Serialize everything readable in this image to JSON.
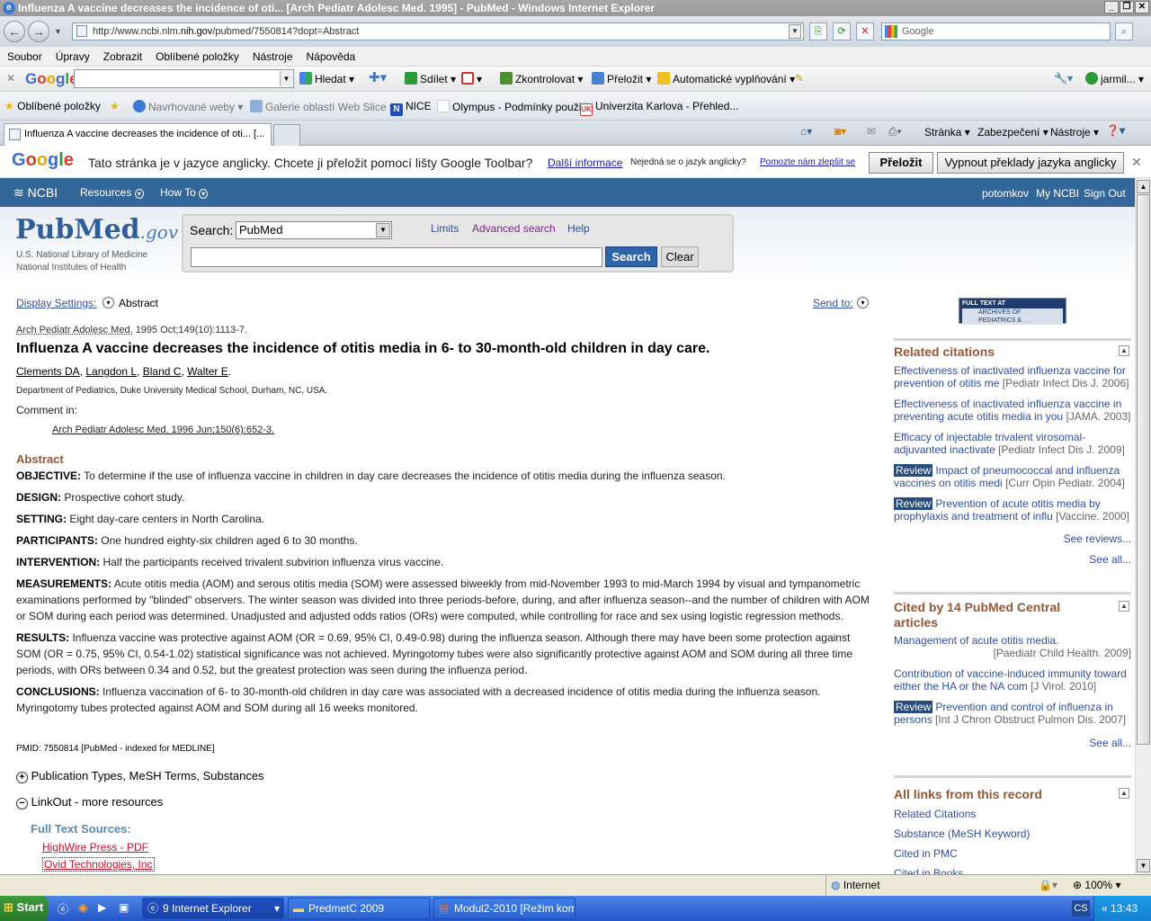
{
  "window": {
    "title": "Influenza A vaccine decreases the incidence of oti... [Arch Pediatr Adolesc Med. 1995] - PubMed - Windows Internet Explorer"
  },
  "address_bar": {
    "url_prefix": "http://www.ncbi.nlm.",
    "url_domain": "nih.gov",
    "url_suffix": "/pubmed/7550814?dopt=Abstract",
    "search_placeholder": "Google"
  },
  "menu": [
    "Soubor",
    "Úpravy",
    "Zobrazit",
    "Oblíbené položky",
    "Nástroje",
    "Nápověda"
  ],
  "google_toolbar": {
    "search_label": "Hledat",
    "share_label": "Sdílet",
    "check_label": "Zkontrolovat",
    "translate_label": "Přeložit",
    "autofill_label": "Automatické vyplňování",
    "user_label": "jarmil..."
  },
  "favorites": {
    "label": "Oblíbené položky",
    "items": [
      "Navrhované weby",
      "Galerie oblastí Web Slice",
      "NICE",
      "Olympus - Podmínky použití",
      "Univerzita Karlova - Přehled..."
    ]
  },
  "tab": {
    "title": "Influenza A vaccine decreases the incidence of oti... [..."
  },
  "command_bar": [
    "Stránka",
    "Zabezpečení",
    "Nástroje"
  ],
  "translate_bar": {
    "message": "Tato stránka je v jazyce anglicky. Chcete ji přeložit pomocí lišty Google Toolbar?",
    "more_info": "Další informace",
    "not_english": "Nejedná se o jazyk anglicky?",
    "help_improve": "Pomozte nám zlepšit se",
    "translate_btn": "Přeložit",
    "disable_btn": "Vypnout překlady jazyka anglicky"
  },
  "ncbi": {
    "logo": "NCBI",
    "resources": "Resources",
    "howto": "How To",
    "user": "potomkov",
    "my_ncbi": "My NCBI",
    "sign_out": "Sign Out"
  },
  "pubmed": {
    "logo_pub": "Pub",
    "logo_med": "Med",
    "logo_gov": ".gov",
    "nlm": "U.S. National Library of Medicine",
    "nih": "National Institutes of Health",
    "search_label": "Search:",
    "db_selected": "PubMed",
    "limits": "Limits",
    "advanced": "Advanced search",
    "help": "Help",
    "search_btn": "Search",
    "clear_btn": "Clear"
  },
  "article": {
    "display_settings": "Display Settings:",
    "display_value": "Abstract",
    "send_to": "Send to:",
    "journal": "Arch Pediatr Adolesc Med.",
    "citation": "1995 Oct;149(10):1113-7.",
    "title": "Influenza A vaccine decreases the incidence of otitis media in 6- to 30-month-old children in day care.",
    "authors": [
      "Clements DA",
      "Langdon L",
      "Bland C",
      "Walter E"
    ],
    "affiliation": "Department of Pediatrics, Duke University Medical School, Durham, NC, USA.",
    "comment_label": "Comment in:",
    "comment_link": "Arch Pediatr Adolesc Med. 1996 Jun;150(6):652-3.",
    "abstract_heading": "Abstract",
    "abstract": [
      {
        "label": "OBJECTIVE:",
        "text": "To determine if the use of influenza vaccine in children in day care decreases the incidence of otitis media during the influenza season."
      },
      {
        "label": "DESIGN:",
        "text": "Prospective cohort study."
      },
      {
        "label": "SETTING:",
        "text": "Eight day-care centers in North Carolina."
      },
      {
        "label": "PARTICIPANTS:",
        "text": "One hundred eighty-six children aged 6 to 30 months."
      },
      {
        "label": "INTERVENTION:",
        "text": "Half the participants received trivalent subvirion influenza virus vaccine."
      },
      {
        "label": "MEASUREMENTS:",
        "text": "Acute otitis media (AOM) and serous otitis media (SOM) were assessed biweekly from mid-November 1993 to mid-March 1994 by visual and tympanometric examinations performed by \"blinded\" observers. The winter season was divided into three periods-before, during, and after influenza season--and the number of children with AOM or SOM during each period was determined. Unadjusted and adjusted odds ratios (ORs) were computed, while controlling for race and sex using logistic regression methods."
      },
      {
        "label": "RESULTS:",
        "text": "Influenza vaccine was protective against AOM (OR = 0.69, 95% CI, 0.49-0.98) during the influenza season. Although there may have been some protection against SOM (OR = 0.75, 95% CI, 0.54-1.02) statistical significance was not achieved. Myringotomy tubes were also significantly protective against AOM and SOM during all three time periods, with ORs between 0.34 and 0.52, but the greatest protection was seen during the influenza period."
      },
      {
        "label": "CONCLUSIONS:",
        "text": "Influenza vaccination of 6- to 30-month-old children in day care was associated with a decreased incidence of otitis media during the influenza season. Myringotomy tubes protected against AOM and SOM during all 16 weeks monitored."
      }
    ],
    "pmid": "PMID: 7550814 [PubMed - indexed for MEDLINE]",
    "pub_types": "Publication Types, MeSH Terms, Substances",
    "linkout": "LinkOut - more resources",
    "fulltext_heading": "Full Text Sources:",
    "fulltext_links": [
      "HighWire Press - PDF",
      "Ovid Technologies, Inc"
    ]
  },
  "sidebar": {
    "fulltext_badge_line1": "FULL TEXT AT",
    "fulltext_badge_line2": "ARCHIVES OF",
    "fulltext_badge_line3": "PEDIATRICS & . . .",
    "related_title": "Related citations",
    "related": [
      {
        "review": false,
        "text": "Effectiveness of inactivated influenza vaccine for prevention of otitis me",
        "cite": "[Pediatr Infect Dis J. 2006]"
      },
      {
        "review": false,
        "text": "Effectiveness of inactivated influenza vaccine in preventing acute otitis media in you",
        "cite": "[JAMA. 2003]"
      },
      {
        "review": false,
        "text": "Efficacy of injectable trivalent virosomal-adjuvanted inactivate",
        "cite": "[Pediatr Infect Dis J. 2009]"
      },
      {
        "review": true,
        "text": "Impact of pneumococcal and influenza vaccines on otitis medi",
        "cite": "[Curr Opin Pediatr. 2004]"
      },
      {
        "review": true,
        "text": "Prevention of acute otitis media by prophylaxis and treatment of influ",
        "cite": "[Vaccine. 2000]"
      }
    ],
    "review_label": "Review",
    "see_reviews": "See reviews...",
    "see_all": "See all...",
    "cited_title": "Cited by 14 PubMed Central articles",
    "cited": [
      {
        "review": false,
        "text": "Management of acute otitis media.",
        "cite": "[Paediatr Child Health. 2009]"
      },
      {
        "review": false,
        "text": "Contribution of vaccine-induced immunity toward either the HA or the NA com",
        "cite": "[J Virol. 2010]"
      },
      {
        "review": true,
        "text": "Prevention and control of influenza in persons",
        "cite": "[Int J Chron Obstruct Pulmon Dis. 2007]"
      }
    ],
    "links_title": "All links from this record",
    "links": [
      "Related Citations",
      "Substance (MeSH Keyword)",
      "Cited in PMC",
      "Cited in Books"
    ]
  },
  "status": {
    "zone": "Internet",
    "zoom": "100%"
  },
  "taskbar": {
    "start": "Start",
    "tasks": [
      "9 Internet Explorer",
      "PredmetC 2009",
      "Modul2-2010 [Režim kom..."
    ],
    "lang": "CS",
    "time": "13:43"
  }
}
